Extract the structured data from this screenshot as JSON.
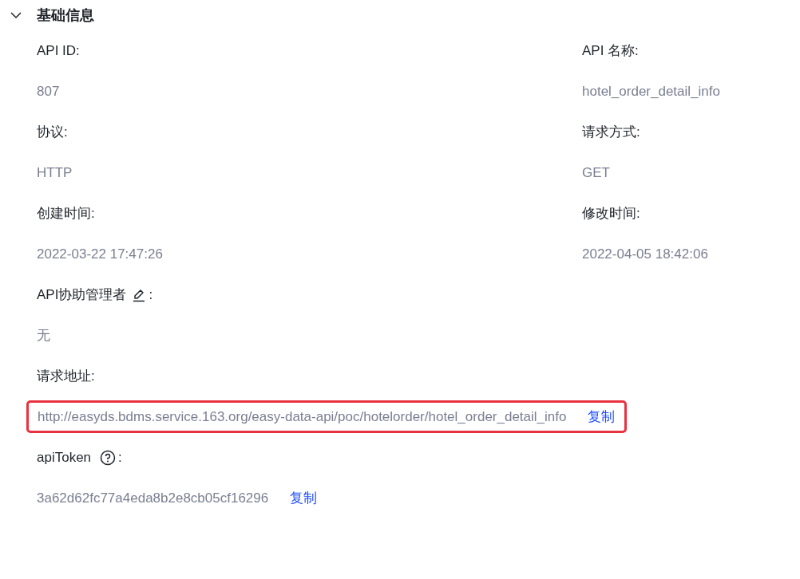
{
  "section": {
    "title": "基础信息",
    "expanded": true,
    "rows": [
      [
        {
          "kind": "plain",
          "label": "API ID:",
          "value": "807"
        },
        {
          "kind": "plain",
          "label": "API 名称:",
          "value": "hotel_order_detail_info"
        }
      ],
      [
        {
          "kind": "plain",
          "label": "协议:",
          "value": "HTTP"
        },
        {
          "kind": "plain",
          "label": "请求方式:",
          "value": "GET"
        }
      ],
      [
        {
          "kind": "plain",
          "label": "创建时间:",
          "value": "2022-03-22 17:47:26"
        },
        {
          "kind": "plain",
          "label": "修改时间:",
          "value": "2022-04-05 18:42:06"
        }
      ],
      [
        {
          "kind": "editable",
          "label": "API协助管理者",
          "label_suffix": ":",
          "value": "无"
        }
      ],
      [
        {
          "kind": "plain",
          "label": "请求地址:",
          "value": "http://easyds.bdms.service.163.org/easy-data-api/poc/hotelorder/hotel_order_detail_info",
          "copy": "复制",
          "highlighted": true
        }
      ],
      [
        {
          "kind": "help",
          "label": "apiToken",
          "label_suffix": ":",
          "value": "3a62d62fc77a4eda8b2e8cb05cf16296",
          "copy": "复制",
          "highlighted": false
        }
      ]
    ]
  }
}
